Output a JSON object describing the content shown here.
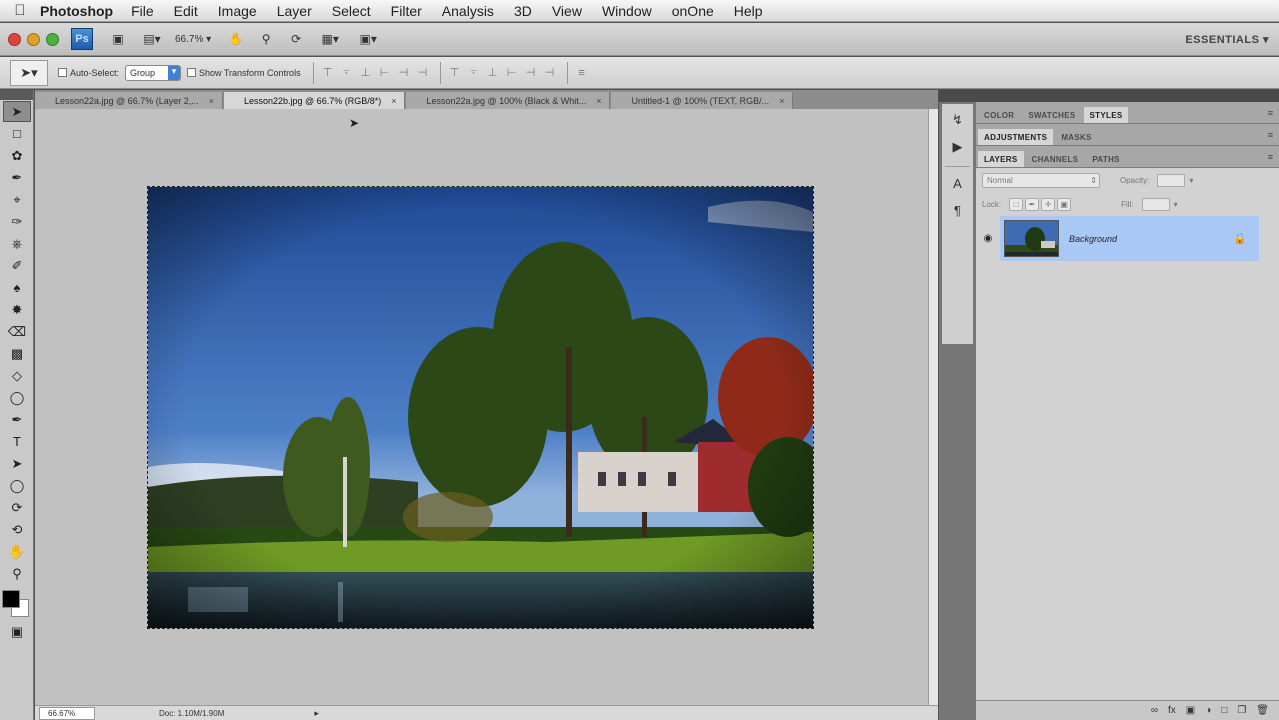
{
  "menubar": {
    "app_name": "Photoshop",
    "items": [
      "File",
      "Edit",
      "Image",
      "Layer",
      "Select",
      "Filter",
      "Analysis",
      "3D",
      "View",
      "Window",
      "onOne",
      "Help"
    ]
  },
  "appbar": {
    "logo": "Ps",
    "zoom": "66.7%",
    "workspace": "ESSENTIALS ▾"
  },
  "options": {
    "auto_select_label": "Auto-Select:",
    "auto_select_value": "Group",
    "transform_label": "Show Transform Controls"
  },
  "tabs": [
    {
      "label": "Lesson22a.jpg @ 66.7% (Layer 2,...",
      "active": false
    },
    {
      "label": "Lesson22b.jpg @ 66.7% (RGB/8*)",
      "active": true
    },
    {
      "label": "Lesson22a.jpg @ 100% (Black & Whit...",
      "active": false
    },
    {
      "label": "Untitled-1 @ 100% (TEXT, RGB/...",
      "active": false
    }
  ],
  "status": {
    "zoom": "66.67%",
    "doc": "Doc: 1.10M/1.90M"
  },
  "panels": {
    "group1_tabs": [
      "COLOR",
      "SWATCHES",
      "STYLES"
    ],
    "group2_tabs": [
      "ADJUSTMENTS",
      "MASKS"
    ],
    "group3_tabs": [
      "LAYERS",
      "CHANNELS",
      "PATHS"
    ],
    "blend_mode": "Normal",
    "opacity_label": "Opacity:",
    "lock_label": "Lock:",
    "fill_label": "Fill:",
    "layer_name": "Background"
  },
  "colors": {
    "selection_highlight": "#a9c8f6",
    "canvas_bg": "#c1c1c1"
  }
}
